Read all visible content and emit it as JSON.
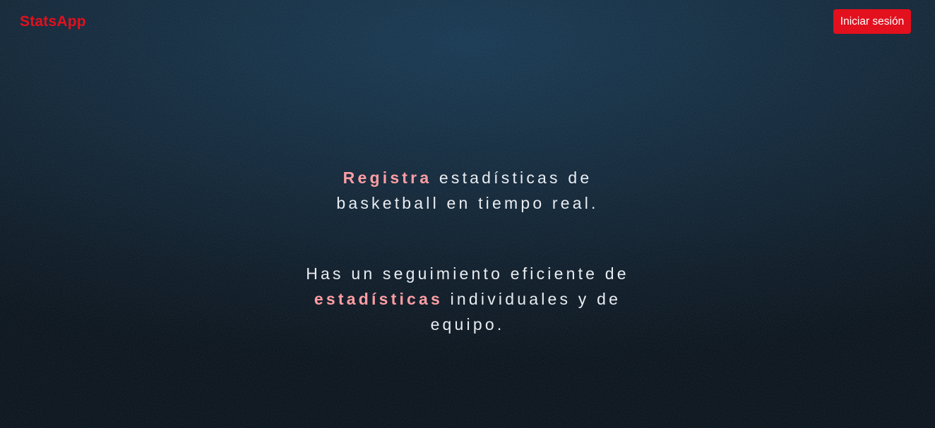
{
  "header": {
    "brand": "StatsApp",
    "login_label": "Iniciar sesión"
  },
  "hero": {
    "line1": {
      "highlight": "Registra",
      "text_after": " estadísticas de",
      "text_line2": "basketball en tiempo real."
    },
    "line2": {
      "text_line1": "Has un seguimiento eficiente de",
      "highlight": "estadísticas",
      "text_after": " individuales y de",
      "text_line3": "equipo."
    }
  },
  "colors": {
    "accent": "#e3101e",
    "highlight": "#ff9ea4",
    "background": "#0c1b28",
    "text": "#e9edf2"
  }
}
